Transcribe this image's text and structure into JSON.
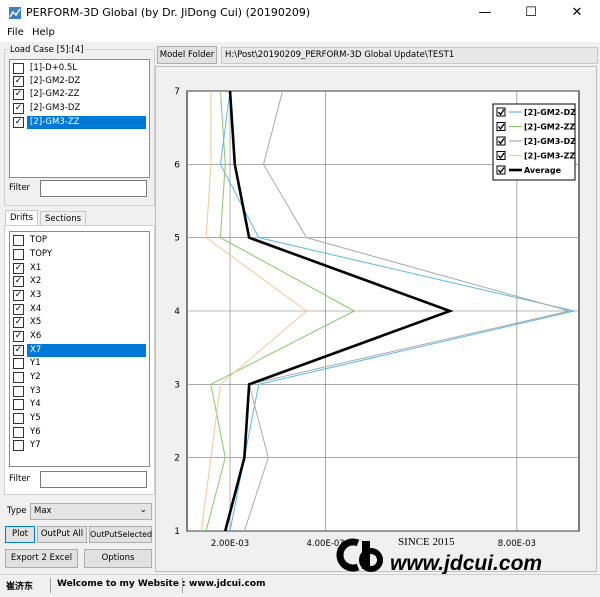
{
  "window": {
    "title": "PERFORM-3D Global (by Dr. JiDong Cui) (20190209)",
    "controls": {
      "minimize": "—",
      "maximize": "☐",
      "close": "✕"
    }
  },
  "menu": {
    "items": [
      "File",
      "Help"
    ]
  },
  "load_case": {
    "label": "Load Case [5]:[4]",
    "items": [
      {
        "label": "[1]-D+0.5L",
        "checked": false,
        "selected": false
      },
      {
        "label": "[2]-GM2-DZ",
        "checked": true,
        "selected": false
      },
      {
        "label": "[2]-GM2-ZZ",
        "checked": true,
        "selected": false
      },
      {
        "label": "[2]-GM3-DZ",
        "checked": true,
        "selected": false
      },
      {
        "label": "[2]-GM3-ZZ",
        "checked": true,
        "selected": true
      }
    ],
    "filter_label": "Filter",
    "filter_value": ""
  },
  "tabs": [
    {
      "label": "Drifts",
      "active": true
    },
    {
      "label": "Sections",
      "active": false
    }
  ],
  "drifts": {
    "items": [
      {
        "label": "TOP",
        "checked": false,
        "selected": false
      },
      {
        "label": "TOPY",
        "checked": false,
        "selected": false
      },
      {
        "label": "X1",
        "checked": true,
        "selected": false
      },
      {
        "label": "X2",
        "checked": true,
        "selected": false
      },
      {
        "label": "X3",
        "checked": true,
        "selected": false
      },
      {
        "label": "X4",
        "checked": true,
        "selected": false
      },
      {
        "label": "X5",
        "checked": true,
        "selected": false
      },
      {
        "label": "X6",
        "checked": true,
        "selected": false
      },
      {
        "label": "X7",
        "checked": true,
        "selected": true
      },
      {
        "label": "Y1",
        "checked": false,
        "selected": false
      },
      {
        "label": "Y2",
        "checked": false,
        "selected": false
      },
      {
        "label": "Y3",
        "checked": false,
        "selected": false
      },
      {
        "label": "Y4",
        "checked": false,
        "selected": false
      },
      {
        "label": "Y5",
        "checked": false,
        "selected": false
      },
      {
        "label": "Y6",
        "checked": false,
        "selected": false
      },
      {
        "label": "Y7",
        "checked": false,
        "selected": false
      }
    ],
    "filter_label": "Filter",
    "filter_value": ""
  },
  "type": {
    "label": "Type",
    "value": "Max"
  },
  "buttons": {
    "plot": "Plot",
    "output_all": "OutPut All",
    "output_selected": "OutPutSelected",
    "export_excel": "Export 2 Excel",
    "options": "Options",
    "model_folder": "Model Folder"
  },
  "path": "H:\\Post\\20190209_PERFORM-3D Global Update\\TEST1",
  "status": {
    "name": "崔济东",
    "welcome": "Welcome to my Website :",
    "url": "www.jdcui.com"
  },
  "watermark": {
    "since": "SINCE 2015",
    "site": "www.jdcui.com"
  },
  "colors": {
    "selection": "#0078d7",
    "gm2_dz": "#5bb8e8",
    "gm2_zz": "#8cc46a",
    "gm3_dz": "#a9a9a9",
    "gm3_zz": "#f0c896",
    "average": "#000000"
  },
  "chart_data": {
    "type": "line",
    "orientation": "drift-vs-story",
    "xlim": [
      0.0011,
      0.0093
    ],
    "ylim": [
      1,
      7
    ],
    "xticks": [
      0.002,
      0.004,
      0.008
    ],
    "xtick_labels": [
      "2.00E-03",
      "4.00E-03",
      "8.00E-03"
    ],
    "yticks": [
      1,
      2,
      3,
      4,
      5,
      6,
      7
    ],
    "ytick_labels": [
      "1",
      "2",
      "3",
      "4",
      "5",
      "6",
      "7"
    ],
    "grid": true,
    "legend_position": "top-right",
    "series": [
      {
        "name": "[2]-GM2-DZ",
        "color": "#5bb8e8",
        "points": [
          [
            0.002,
            1
          ],
          [
            0.0023,
            2
          ],
          [
            0.0026,
            3
          ],
          [
            0.0092,
            4
          ],
          [
            0.0026,
            5
          ],
          [
            0.0018,
            6
          ],
          [
            0.002,
            7
          ]
        ]
      },
      {
        "name": "[2]-GM2-ZZ",
        "color": "#8cc46a",
        "points": [
          [
            0.0015,
            1
          ],
          [
            0.0019,
            2
          ],
          [
            0.0016,
            3
          ],
          [
            0.0046,
            4
          ],
          [
            0.0018,
            5
          ],
          [
            0.0019,
            6
          ],
          [
            0.0018,
            7
          ]
        ]
      },
      {
        "name": "[2]-GM3-DZ",
        "color": "#a9a9a9",
        "points": [
          [
            0.0023,
            1
          ],
          [
            0.0028,
            2
          ],
          [
            0.0024,
            3
          ],
          [
            0.0091,
            4
          ],
          [
            0.0036,
            5
          ],
          [
            0.0027,
            6
          ],
          [
            0.0031,
            7
          ]
        ]
      },
      {
        "name": "[2]-GM3-ZZ",
        "color": "#f0c896",
        "points": [
          [
            0.0014,
            1
          ],
          [
            0.0016,
            2
          ],
          [
            0.0018,
            3
          ],
          [
            0.0036,
            4
          ],
          [
            0.0015,
            5
          ],
          [
            0.0016,
            6
          ],
          [
            0.0016,
            7
          ]
        ]
      },
      {
        "name": "Average",
        "color": "#000000",
        "points": [
          [
            0.0019,
            1
          ],
          [
            0.0023,
            2
          ],
          [
            0.0024,
            3
          ],
          [
            0.0066,
            4
          ],
          [
            0.0024,
            5
          ],
          [
            0.0021,
            6
          ],
          [
            0.002,
            7
          ]
        ]
      }
    ]
  }
}
